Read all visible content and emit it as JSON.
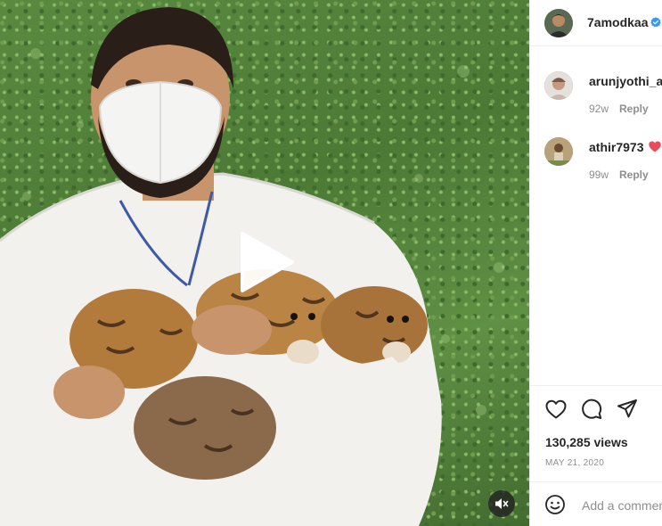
{
  "post": {
    "author": "7amodkaa",
    "verified": true
  },
  "comments": [
    {
      "username": "arunjyothi_aj",
      "age": "92w",
      "reply_label": "Reply"
    },
    {
      "username": "athir7973",
      "age": "99w",
      "reply_label": "Reply",
      "emoji": "red-heart"
    }
  ],
  "actions": {
    "like_icon": "heart-outline-icon",
    "comment_icon": "comment-icon",
    "share_icon": "paper-plane-icon"
  },
  "stats": {
    "views": "130,285 views",
    "date": "MAY 21, 2020"
  },
  "composer": {
    "placeholder": "Add a comment..."
  },
  "video": {
    "play_icon": "play-icon",
    "mute_icon": "muted-speaker-icon"
  },
  "colors": {
    "verified": "#3897f0",
    "heart": "#ed4956",
    "muted_text": "#8e8e8e",
    "divider": "#efefef"
  }
}
